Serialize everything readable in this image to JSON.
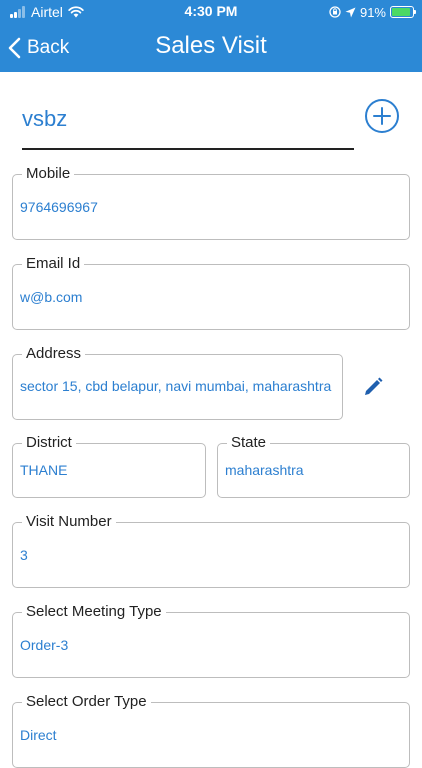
{
  "status_bar": {
    "carrier": "Airtel",
    "time": "4:30 PM",
    "battery_percent": "91%",
    "battery_level": 0.91,
    "icons": [
      "signal-icon",
      "wifi-icon",
      "rotation-lock-icon",
      "location-icon",
      "battery-charging-icon"
    ]
  },
  "nav": {
    "back_label": "Back",
    "title": "Sales Visit"
  },
  "customer": {
    "name": "vsbz"
  },
  "fields": {
    "mobile": {
      "label": "Mobile",
      "value": "9764696967"
    },
    "email": {
      "label": "Email Id",
      "value": "w@b.com"
    },
    "address": {
      "label": "Address",
      "value": "sector 15, cbd belapur, navi mumbai, maharashtra"
    },
    "district": {
      "label": "District",
      "value": "THANE"
    },
    "state": {
      "label": "State",
      "value": "maharashtra"
    },
    "visit_number": {
      "label": "Visit Number",
      "value": "3"
    },
    "meeting_type": {
      "label": "Select Meeting Type",
      "value": "Order-3"
    },
    "order_type": {
      "label": "Select Order Type",
      "value": "Direct"
    }
  },
  "colors": {
    "accent": "#2c89d6",
    "value_text": "#2c7fd0",
    "border": "#bdbdbd"
  }
}
